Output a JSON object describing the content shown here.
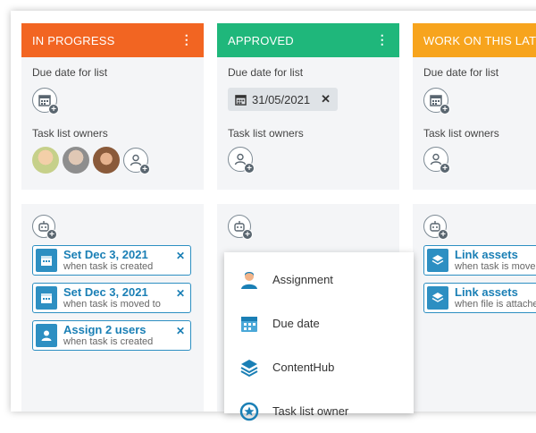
{
  "columns": [
    {
      "title": "IN PROGRESS",
      "color": "#f26522",
      "due_label": "Due date for list",
      "owners_label": "Task list owners",
      "rules": [
        {
          "title": "Set Dec 3, 2021",
          "subtitle": "when task is created",
          "icon": "calendar-icon"
        },
        {
          "title": "Set Dec 3, 2021",
          "subtitle": "when task is moved to",
          "icon": "calendar-icon"
        },
        {
          "title": "Assign 2 users",
          "subtitle": "when task is created",
          "icon": "user-icon"
        }
      ]
    },
    {
      "title": "APPROVED",
      "color": "#1fb77b",
      "due_label": "Due date for list",
      "due_value": "31/05/2021",
      "owners_label": "Task list owners"
    },
    {
      "title": "WORK ON THIS LATER",
      "color": "#f7a41d",
      "due_label": "Due date for list",
      "owners_label": "Task list owners",
      "rules": [
        {
          "title": "Link assets",
          "subtitle": "when task is moved",
          "icon": "layers-icon"
        },
        {
          "title": "Link assets",
          "subtitle": "when file is attached",
          "icon": "layers-icon"
        }
      ]
    }
  ],
  "menu_glyph": "⋮",
  "remove_glyph": "✕",
  "dropdown": {
    "items": [
      {
        "label": "Assignment",
        "icon": "user-icon"
      },
      {
        "label": "Due date",
        "icon": "calendar-icon"
      },
      {
        "label": "ContentHub",
        "icon": "layers-icon"
      },
      {
        "label": "Task list owner",
        "icon": "badge-icon"
      }
    ]
  }
}
